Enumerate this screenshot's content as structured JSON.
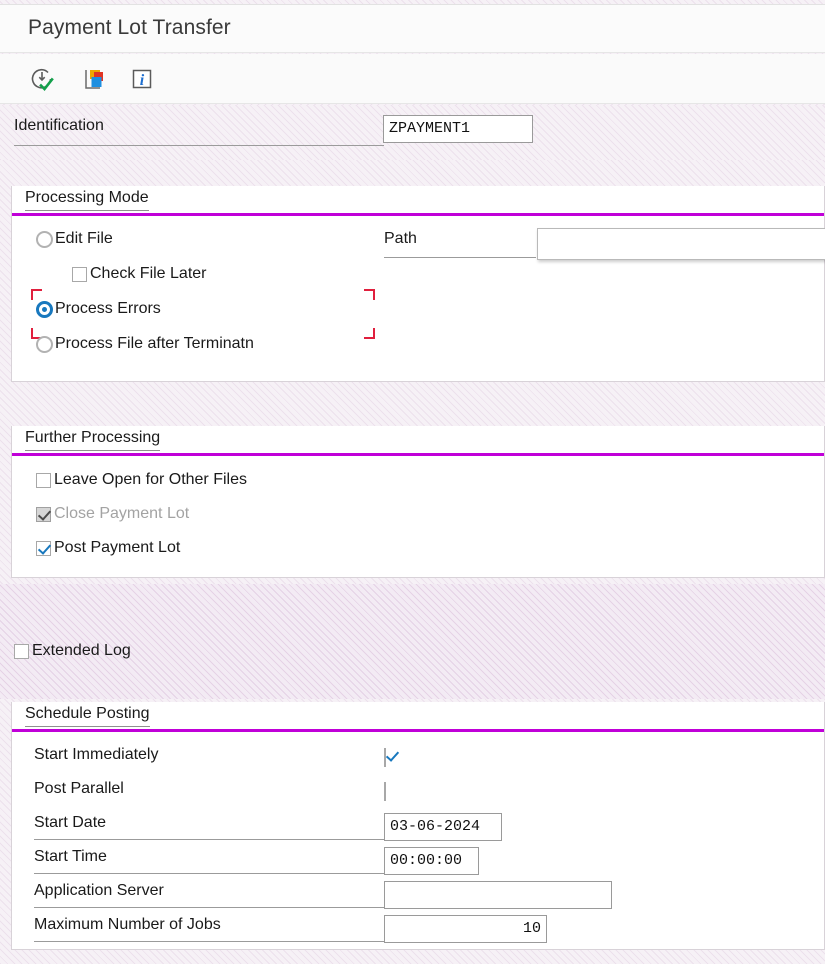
{
  "window": {
    "title": "Payment Lot Transfer"
  },
  "toolbar": {
    "items": [
      {
        "name": "execute-icon",
        "label": "Execute"
      },
      {
        "name": "variants-icon",
        "label": "Get Variant"
      },
      {
        "name": "info-icon",
        "label": "Information"
      }
    ]
  },
  "identification": {
    "label": "Identification",
    "value": "ZPAYMENT1"
  },
  "processing_mode": {
    "title": "Processing Mode",
    "options": [
      {
        "label": "Edit File",
        "selected": false
      },
      {
        "label": "Process Errors",
        "selected": true
      },
      {
        "label": "Process File after Terminatn",
        "selected": false
      }
    ],
    "check_file_later": {
      "label": "Check File Later",
      "checked": false
    },
    "path": {
      "label": "Path",
      "value": ""
    }
  },
  "further_processing": {
    "title": "Further Processing",
    "checkboxes": [
      {
        "label": "Leave Open for Other Files",
        "checked": false,
        "disabled": false
      },
      {
        "label": "Close Payment Lot",
        "checked": true,
        "disabled": true
      },
      {
        "label": "Post Payment Lot",
        "checked": true,
        "disabled": false
      }
    ]
  },
  "extended_log": {
    "label": "Extended Log",
    "checked": false
  },
  "schedule_posting": {
    "title": "Schedule Posting",
    "rows": [
      {
        "label": "Start Immediately",
        "type": "checkbox",
        "checked": true
      },
      {
        "label": "Post Parallel",
        "type": "checkbox",
        "checked": false
      },
      {
        "label": "Start Date",
        "type": "input",
        "value": "03-06-2024"
      },
      {
        "label": "Start Time",
        "type": "input",
        "value": "00:00:00"
      },
      {
        "label": "Application Server",
        "type": "input",
        "value": ""
      },
      {
        "label": "Maximum Number of Jobs",
        "type": "input",
        "value": "10"
      }
    ]
  },
  "colors": {
    "accent_rule": "#c000d8",
    "selected_radio": "#1878be",
    "focus_bracket": "#e01f3d",
    "hatch_background": "#f6f1f6"
  }
}
